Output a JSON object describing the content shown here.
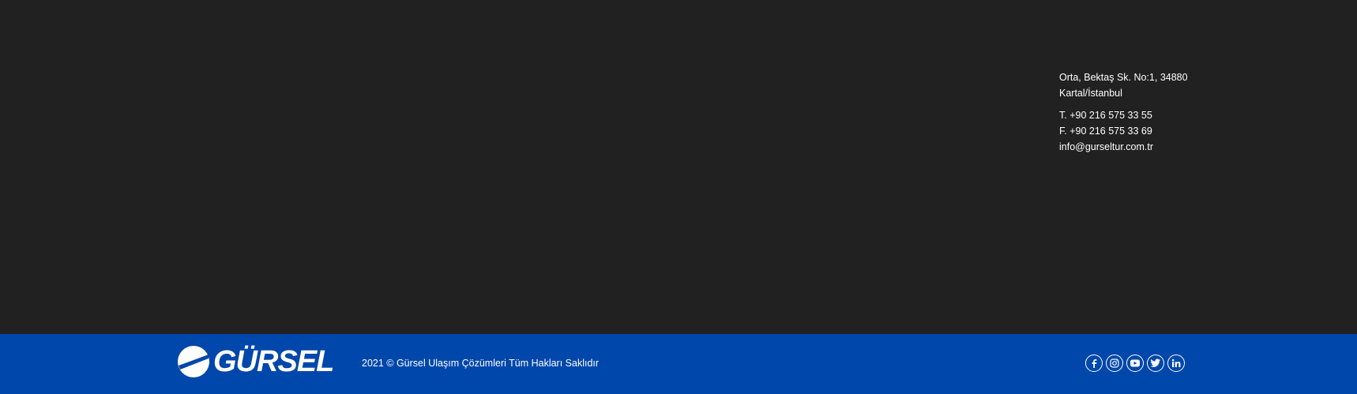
{
  "contact": {
    "address_line1": "Orta, Bektaş Sk. No:1, 34880",
    "address_line2": "Kartal/İstanbul",
    "phone": "T. +90 216 575 33 55",
    "fax": "F. +90 216 575 33 69",
    "email": "info@gurseltur.com.tr"
  },
  "footer": {
    "logo_text": "GÜRSEL",
    "copyright": "2021 © Gürsel Ulaşım Çözümleri Tüm Hakları Saklıdır",
    "social": [
      {
        "icon": "facebook-icon"
      },
      {
        "icon": "instagram-icon"
      },
      {
        "icon": "youtube-icon"
      },
      {
        "icon": "twitter-icon"
      },
      {
        "icon": "linkedin-icon"
      }
    ]
  },
  "colors": {
    "top_background": "#212121",
    "bottom_background": "#0047ab",
    "text": "#ffffff"
  }
}
